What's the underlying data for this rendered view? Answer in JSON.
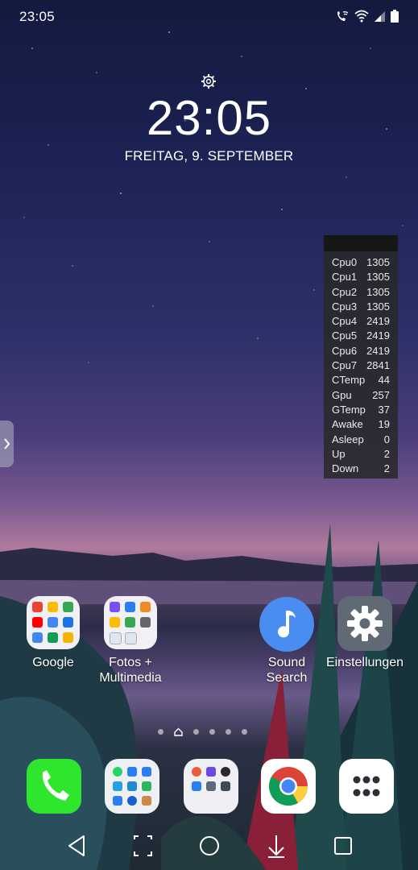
{
  "status_bar": {
    "time": "23:05",
    "icons": [
      "wifi-calling-icon",
      "wifi-icon",
      "signal-icon",
      "battery-icon"
    ]
  },
  "lockscreen": {
    "clock": "23:05",
    "date": "FREITAG, 9. SEPTEMBER"
  },
  "cpu_widget": {
    "rows": [
      {
        "label": "Cpu0",
        "value": "1305"
      },
      {
        "label": "Cpu1",
        "value": "1305"
      },
      {
        "label": "Cpu2",
        "value": "1305"
      },
      {
        "label": "Cpu3",
        "value": "1305"
      },
      {
        "label": "Cpu4",
        "value": "2419"
      },
      {
        "label": "Cpu5",
        "value": "2419"
      },
      {
        "label": "Cpu6",
        "value": "2419"
      },
      {
        "label": "Cpu7",
        "value": "2841"
      },
      {
        "label": "CTemp",
        "value": "44"
      },
      {
        "label": "Gpu",
        "value": "257"
      },
      {
        "label": "GTemp",
        "value": "37"
      },
      {
        "label": "Awake",
        "value": "19"
      },
      {
        "label": "Asleep",
        "value": "0"
      },
      {
        "label": "Up",
        "value": "2"
      },
      {
        "label": "Down",
        "value": "2"
      }
    ]
  },
  "home_apps": [
    {
      "label": "Google"
    },
    {
      "label": "Fotos +\nMultimedia"
    },
    {
      "label": "Sound\nSearch"
    },
    {
      "label": "Einstellungen"
    }
  ],
  "dock": [
    "phone-icon",
    "messaging-folder-icon",
    "tools-folder-icon",
    "chrome-icon",
    "app-drawer-icon"
  ],
  "nav": [
    "back-button",
    "screenshot-button",
    "home-button",
    "notification-pull-button",
    "recents-button"
  ],
  "colors": {
    "phone_green": "#2ee62e",
    "sound_search_blue": "#4a8df0",
    "settings_gray": "#5f6a74"
  }
}
